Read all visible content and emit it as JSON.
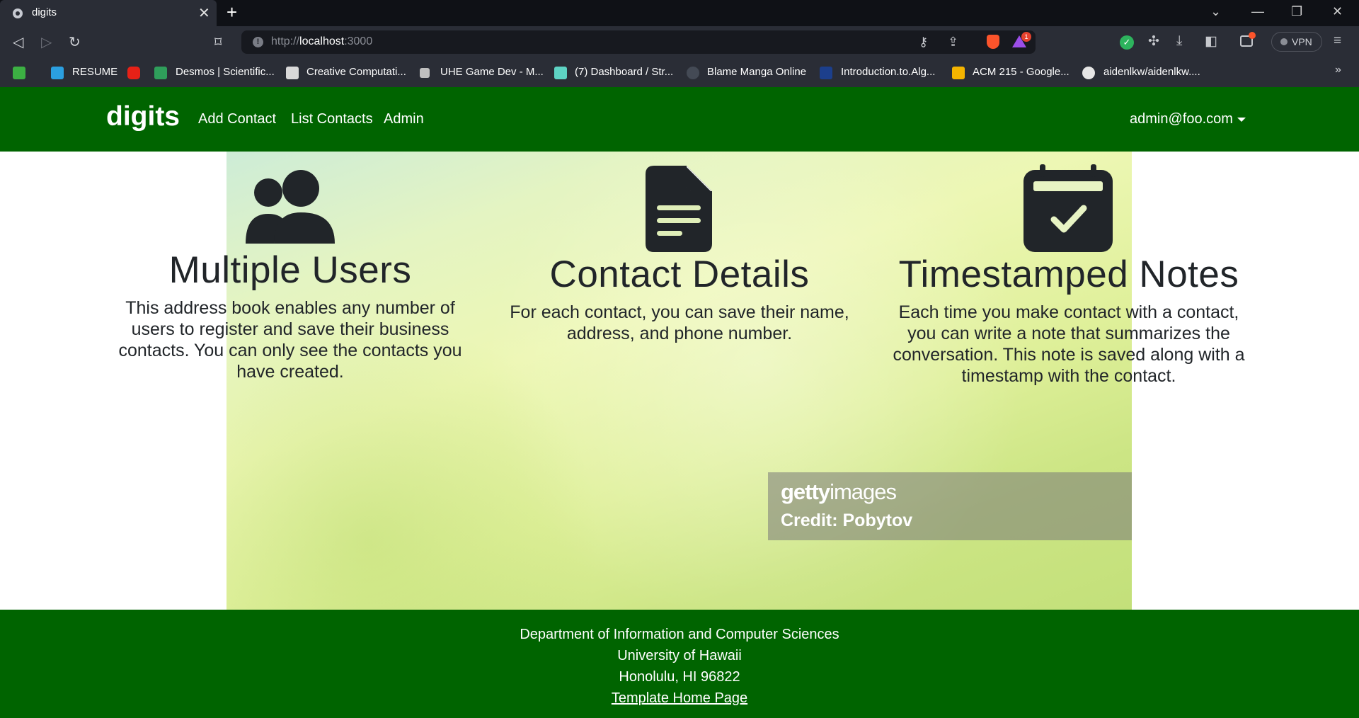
{
  "browser": {
    "tab_title": "digits",
    "url_scheme": "http://",
    "url_host": "localhost",
    "url_port": ":3000",
    "brave_badge": "1",
    "vpn_label": "VPN",
    "bookmarks": [
      {
        "label": "",
        "icon_color": "#3cb043"
      },
      {
        "label": "RESUME",
        "icon_color": "#2b9fe0"
      },
      {
        "label": "",
        "icon_color": "#e62117"
      },
      {
        "label": "Desmos | Scientific...",
        "icon_color": "#2f9e5b"
      },
      {
        "label": "Creative Computati...",
        "icon_color": "#d9d9d9"
      },
      {
        "label": "UHE Game Dev - M...",
        "icon_color": "#bfbfbf"
      },
      {
        "label": "(7) Dashboard / Str...",
        "icon_color": "#5ed3c4"
      },
      {
        "label": "Blame Manga Online",
        "icon_color": "#444a55"
      },
      {
        "label": "Introduction.to.Alg...",
        "icon_color": "#1c3f8c"
      },
      {
        "label": "ACM 215 - Google...",
        "icon_color": "#f4b400"
      },
      {
        "label": "aidenlkw/aidenlkw....",
        "icon_color": "#e6e6e6"
      }
    ]
  },
  "navbar": {
    "brand": "digits",
    "links": [
      "Add Contact",
      "List Contacts",
      "Admin"
    ],
    "user": "admin@foo.com"
  },
  "hero": {
    "watermark_logo_bold": "getty",
    "watermark_logo_light": "images",
    "watermark_credit": "Credit: Pobytov"
  },
  "features": [
    {
      "icon": "users-icon",
      "title": "Multiple Users",
      "text": "This address book enables any number of users to register and save their business contacts. You can only see the contacts you have created."
    },
    {
      "icon": "file-icon",
      "title": "Contact Details",
      "text": "For each contact, you can save their name, address, and phone number."
    },
    {
      "icon": "calendar-check-icon",
      "title": "Timestamped Notes",
      "text": "Each time you make contact with a contact, you can write a note that summarizes the conversation. This note is saved along with a timestamp with the contact."
    }
  ],
  "footer": {
    "line1": "Department of Information and Computer Sciences",
    "line2": "University of Hawaii",
    "line3": "Honolulu, HI 96822",
    "link": "Template Home Page"
  },
  "colors": {
    "brand_green": "#006400",
    "chrome_dark": "#2a2d36"
  }
}
